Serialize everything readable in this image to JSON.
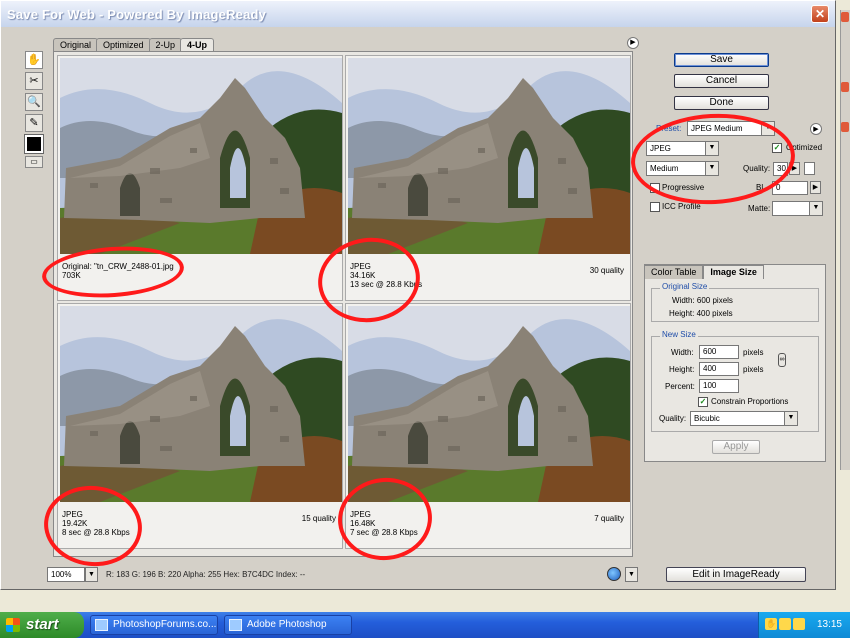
{
  "window": {
    "title": "Save For Web - Powered By ImageReady",
    "close_glyph": "✕"
  },
  "tabs": [
    {
      "label": "Original",
      "active": false
    },
    {
      "label": "Optimized",
      "active": false
    },
    {
      "label": "2-Up",
      "active": false
    },
    {
      "label": "4-Up",
      "active": true
    }
  ],
  "panes": [
    {
      "line1": "Original: \"tn_CRW_2488-01.jpg",
      "line2": "703K",
      "line3": "",
      "quality": ""
    },
    {
      "line1": "JPEG",
      "line2": "34.16K",
      "line3": "13 sec @ 28.8 Kbps",
      "quality": "30 quality"
    },
    {
      "line1": "JPEG",
      "line2": "19.42K",
      "line3": "8 sec @ 28.8 Kbps",
      "quality": "15 quality"
    },
    {
      "line1": "JPEG",
      "line2": "16.48K",
      "line3": "7 sec @ 28.8 Kbps",
      "quality": "7 quality"
    }
  ],
  "buttons": {
    "save": "Save",
    "cancel": "Cancel",
    "done": "Done",
    "apply": "Apply",
    "edit_imageready": "Edit in ImageReady"
  },
  "settings": {
    "preset_label": "Preset:",
    "preset_value": "JPEG Medium",
    "format_value": "JPEG",
    "quality_level_value": "Medium",
    "optimized_label": "Optimized",
    "optimized_checked": true,
    "quality_label": "Quality:",
    "quality_value": "30",
    "progressive_label": "Progressive",
    "progressive_checked": false,
    "blur_label": "Bl",
    "blur_value": "0",
    "icc_label": "ICC Profile",
    "icc_checked": false,
    "matte_label": "Matte:",
    "matte_value": ""
  },
  "size_tabs": [
    {
      "label": "Color Table",
      "active": false
    },
    {
      "label": "Image Size",
      "active": true
    }
  ],
  "image_size": {
    "original_group": "Original Size",
    "orig_width": "Width: 600 pixels",
    "orig_height": "Height: 400 pixels",
    "new_group": "New Size",
    "width_label": "Width:",
    "width_value": "600",
    "height_label": "Height:",
    "height_value": "400",
    "percent_label": "Percent:",
    "percent_value": "100",
    "pixels_label": "pixels",
    "constrain_label": "Constrain Proportions",
    "constrain_checked": true,
    "quality_label": "Quality:",
    "quality_value": "Bicubic"
  },
  "status": {
    "zoom": "100%",
    "readout": "R: 183   G: 196   B: 220   Alpha: 255   Hex: B7C4DC   Index: --"
  },
  "taskbar": {
    "start_label": "start",
    "tasks": [
      {
        "label": "PhotoshopForums.co..."
      },
      {
        "label": "Adobe Photoshop"
      }
    ],
    "clock": "13:15"
  },
  "colors": {
    "annotation_red": "#ff1a1a",
    "sky": "#b7c4dc"
  },
  "icons": {
    "hand": "✋",
    "slice": "✂",
    "zoom": "🔍",
    "eyedropper": "✎",
    "preview": "▭",
    "dropdown": "▼",
    "arrow_right": "▶",
    "menu": "▶",
    "check": "✓",
    "link": "∞"
  }
}
